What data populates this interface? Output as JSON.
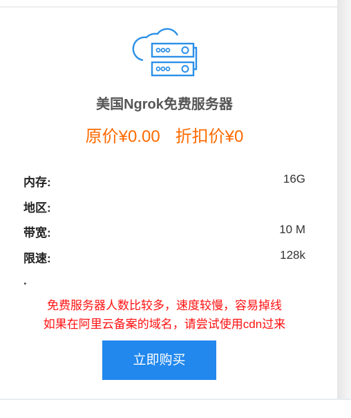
{
  "product": {
    "icon": "cloud-server-icon",
    "title": "美国Ngrok免费服务器",
    "original_price": "原价¥0.00",
    "discount_price": "折扣价¥0"
  },
  "specs": [
    {
      "label": "内存:",
      "value": "16G"
    },
    {
      "label": "地区:",
      "value": ""
    },
    {
      "label": "带宽:",
      "value": "10 M"
    },
    {
      "label": "限速:",
      "value": "128k"
    }
  ],
  "extra": ".",
  "notice": [
    "免费服务器人数比较多，速度较慢，容易掉线",
    "如果在阿里云备案的域名，请尝试使用cdn过来"
  ],
  "buy_button": "立即购买",
  "colors": {
    "accent": "#2288ee",
    "price": "#ff6a00",
    "notice": "#ff1111"
  }
}
